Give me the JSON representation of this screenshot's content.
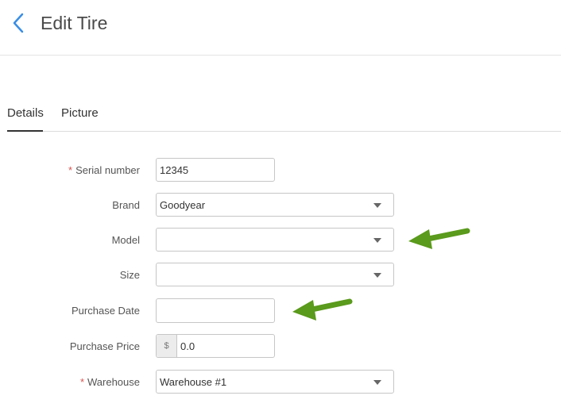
{
  "header": {
    "title": "Edit Tire"
  },
  "tabs": [
    {
      "label": "Details",
      "active": true
    },
    {
      "label": "Picture",
      "active": false
    }
  ],
  "form": {
    "serial_number": {
      "label": "Serial number",
      "required": true,
      "value": "12345"
    },
    "brand": {
      "label": "Brand",
      "value": "Goodyear"
    },
    "model": {
      "label": "Model",
      "value": ""
    },
    "size": {
      "label": "Size",
      "value": ""
    },
    "purchase_date": {
      "label": "Purchase Date",
      "value": ""
    },
    "purchase_price": {
      "label": "Purchase Price",
      "currency_symbol": "$",
      "value": "0.0"
    },
    "warehouse": {
      "label": "Warehouse",
      "required": true,
      "value": "Warehouse #1"
    }
  },
  "colors": {
    "accent": "#3a8ee6",
    "required": "#d9534f",
    "annotation_arrow": "#5a9a1c"
  },
  "icons": {
    "back": "chevron-left-icon",
    "dropdown": "caret-down-icon",
    "annotation": "green-arrow-icon"
  }
}
